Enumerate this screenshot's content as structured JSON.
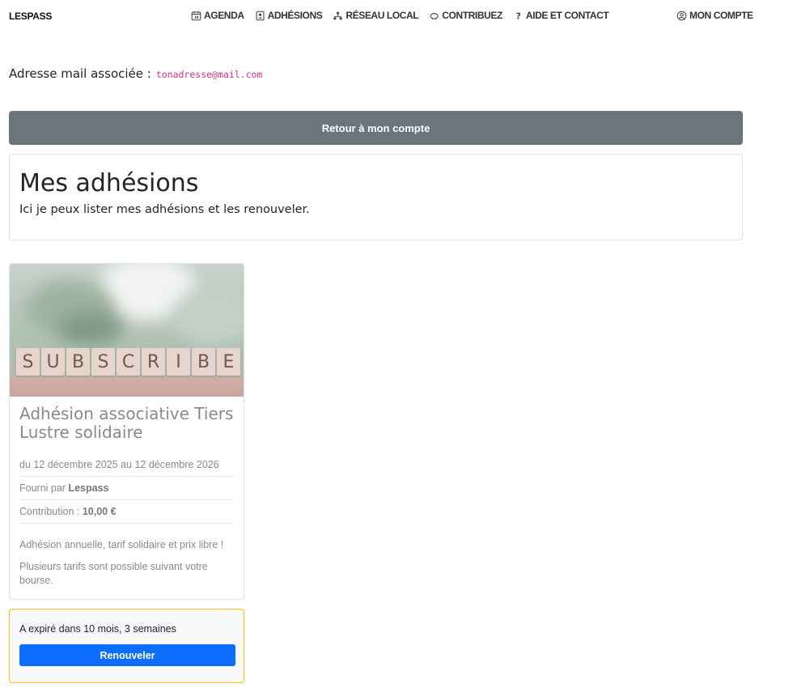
{
  "navbar": {
    "brand": "LESPASS",
    "links": [
      {
        "label": "AGENDA",
        "icon": "calendar-icon"
      },
      {
        "label": "ADHÉSIONS",
        "icon": "id-badge-icon"
      },
      {
        "label": "RÉSEAU LOCAL",
        "icon": "network-icon"
      },
      {
        "label": "CONTRIBUEZ",
        "icon": "piggy-bank-icon"
      },
      {
        "label": "AIDE ET CONTACT",
        "icon": "question-icon"
      }
    ],
    "account": {
      "label": "MON COMPTE",
      "icon": "user-circle-icon"
    }
  },
  "email": {
    "label": "Adresse mail associée :",
    "value": "tonadresse@mail.com"
  },
  "back_button": "Retour à mon compte",
  "header": {
    "title": "Mes adhésions",
    "subtitle": "Ici je peux lister mes adhésions et les renouveler."
  },
  "membership": {
    "image_letters": [
      "S",
      "U",
      "B",
      "S",
      "C",
      "R",
      "I",
      "B",
      "E"
    ],
    "title": "Adhésion associative Tiers Lustre solidaire",
    "dates": "du 12 décembre 2025 au 12 décembre 2026",
    "provider_prefix": "Fourni par",
    "provider": "Lespass",
    "contribution_prefix": "Contribution :",
    "contribution": "10,00 €",
    "description": [
      "Adhésion annuelle, tarif solidaire et prix libre !",
      "Plusieurs tarifs sont possible suivant votre bourse."
    ]
  },
  "status": {
    "text": "A expiré dans 10 mois, 3 semaines",
    "renew_label": "Renouveler"
  },
  "colors": {
    "secondary": "#6c757d",
    "primary": "#0d6efd",
    "warning_border": "#ffc107",
    "code": "#d63384"
  }
}
